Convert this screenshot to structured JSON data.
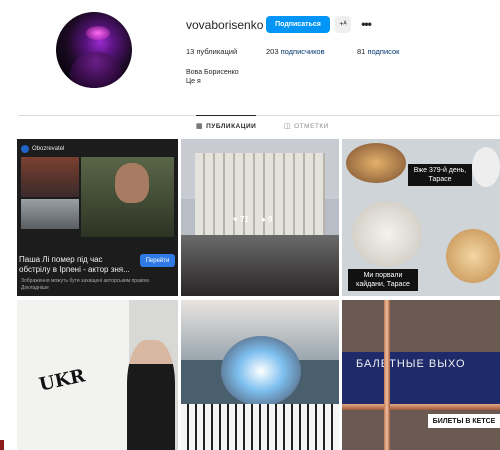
{
  "profile": {
    "username": "vovaborisenko",
    "follow_label": "Подписаться",
    "suggest_label": "+ᴬ",
    "more_label": "•••",
    "stats": {
      "posts_count": "13",
      "posts_label": "публикаций",
      "followers_count": "203",
      "followers_label": "подписчиков",
      "following_count": "81",
      "following_label": "подписок"
    },
    "full_name": "Вова Борисенко",
    "bio": "Це я"
  },
  "tabs": [
    {
      "label": "ПУБЛИКАЦИИ",
      "icon": "grid-icon",
      "active": true
    },
    {
      "label": "ОТМЕТКИ",
      "icon": "tag-icon",
      "active": false
    }
  ],
  "posts": {
    "p1": {
      "source": "Obozrevatel",
      "headline": "Паша Лі помер під час обстрілу в Ірпені - актор зня...",
      "button": "Перейти",
      "note": "Зображення можуть бути захищені авторським правом. Докладніше"
    },
    "p2": {
      "likes": "71",
      "comments": "0"
    },
    "p3": {
      "caption_top": "Вже 379-й день, Тарасе",
      "caption_bottom": "Ми порвали кайдани, Тарасе"
    },
    "p4": {
      "graffiti": "UKR"
    },
    "p6": {
      "banner": "БАЛЕТНЫЕ ВЫХО",
      "tickets": "БИЛЕТЫ В КЕТСЕ"
    }
  },
  "colors": {
    "accent": "#0095f6",
    "link": "#00376b",
    "text": "#262626",
    "muted": "#8e8e8e"
  }
}
